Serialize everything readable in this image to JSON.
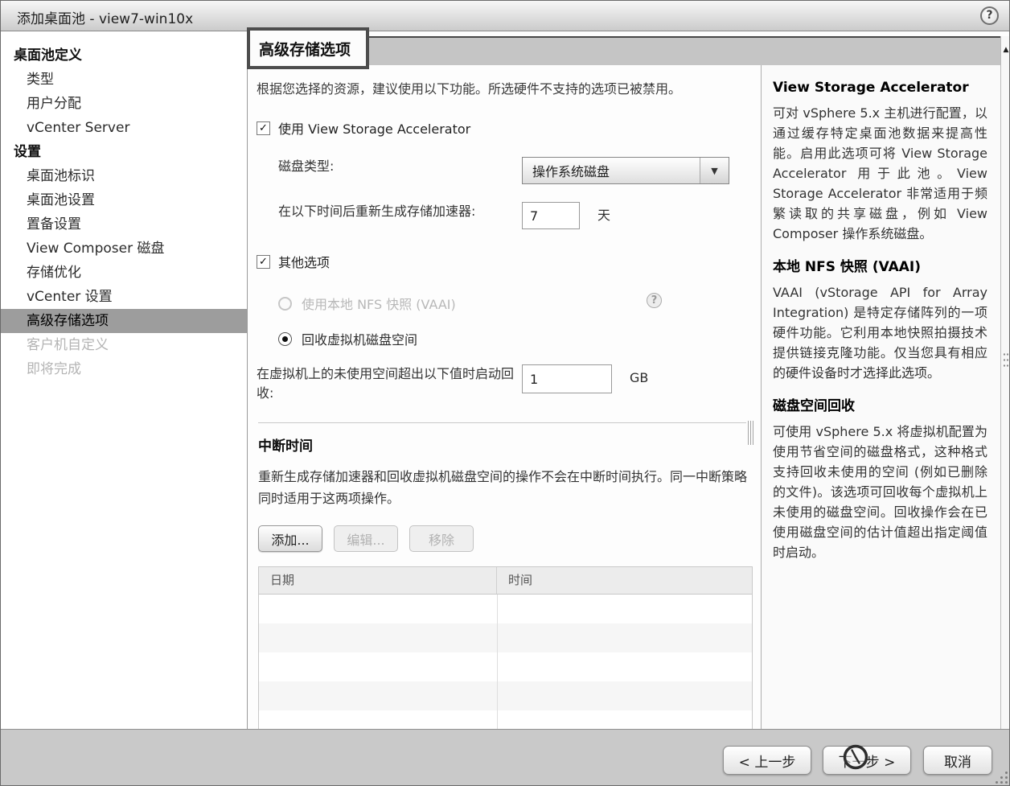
{
  "window": {
    "title": "添加桌面池 - view7-win10x"
  },
  "icons": {
    "help": "?",
    "check": "✓",
    "dropdown_arrow": "▼",
    "scroll_up_arrow": "▲"
  },
  "sidebar": {
    "groups": [
      {
        "label": "桌面池定义",
        "items": [
          {
            "label": "类型",
            "state": "normal"
          },
          {
            "label": "用户分配",
            "state": "normal"
          },
          {
            "label": "vCenter Server",
            "state": "normal"
          }
        ]
      },
      {
        "label": "设置",
        "items": [
          {
            "label": "桌面池标识",
            "state": "normal"
          },
          {
            "label": "桌面池设置",
            "state": "normal"
          },
          {
            "label": "置备设置",
            "state": "normal"
          },
          {
            "label": "View Composer 磁盘",
            "state": "normal"
          },
          {
            "label": "存储优化",
            "state": "normal"
          },
          {
            "label": "vCenter 设置",
            "state": "normal"
          },
          {
            "label": "高级存储选项",
            "state": "active"
          },
          {
            "label": "客户机自定义",
            "state": "disabled"
          },
          {
            "label": "即将完成",
            "state": "disabled"
          }
        ]
      }
    ]
  },
  "main": {
    "header": "高级存储选项",
    "intro": "根据您选择的资源，建议使用以下功能。所选硬件不支持的选项已被禁用。",
    "storage_accelerator": {
      "checkbox_label": "使用 View Storage Accelerator",
      "checked": true,
      "disk_type_label": "磁盘类型:",
      "disk_type_value": "操作系统磁盘",
      "regenerate_label": "在以下时间后重新生成存储加速器:",
      "regenerate_value": "7",
      "regenerate_unit": "天"
    },
    "other_options": {
      "checkbox_label": "其他选项",
      "checked": true,
      "nfs_radio_label": "使用本地 NFS 快照 (VAAI)",
      "nfs_radio_selected": false,
      "nfs_radio_disabled": true,
      "reclaim_radio_label": "回收虚拟机磁盘空间",
      "reclaim_radio_selected": true,
      "threshold_label": "在虚拟机上的未使用空间超出以下值时启动回收:",
      "threshold_value": "1",
      "threshold_unit": "GB"
    },
    "blackout": {
      "title": "中断时间",
      "description": "重新生成存储加速器和回收虚拟机磁盘空间的操作不会在中断时间执行。同一中断策略同时适用于这两项操作。",
      "add_button": "添加...",
      "edit_button": "编辑...",
      "remove_button": "移除",
      "table": {
        "columns": [
          "日期",
          "时间"
        ],
        "rows": []
      }
    }
  },
  "help_panel": {
    "sections": [
      {
        "title": "View Storage Accelerator",
        "body": "可对 vSphere 5.x 主机进行配置，以通过缓存特定桌面池数据来提高性能。启用此选项可将 View Storage Accelerator 用于此池。View Storage Accelerator 非常适用于频繁读取的共享磁盘，例如 View Composer 操作系统磁盘。"
      },
      {
        "title": "本地 NFS 快照 (VAAI)",
        "body": "VAAI (vStorage API for Array Integration) 是特定存储阵列的一项硬件功能。它利用本地快照拍摄技术提供链接克隆功能。仅当您具有相应的硬件设备时才选择此选项。"
      },
      {
        "title": "磁盘空间回收",
        "body": "可使用 vSphere 5.x 将虚拟机配置为使用节省空间的磁盘格式，这种格式支持回收未使用的空间 (例如已删除的文件)。该选项可回收每个虚拟机上未使用的磁盘空间。回收操作会在已使用磁盘空间的估计值超出指定阈值时启动。"
      }
    ]
  },
  "footer": {
    "prev_button": "< 上一步",
    "next_button": "下一步 >",
    "cancel_button": "取消"
  },
  "colors": {
    "band_bg": "#c5c5c5",
    "footer_bg": "#c9c9c9",
    "sidebar_active_bg": "#9d9d9d",
    "annotation_border": "#4d4d4d"
  }
}
